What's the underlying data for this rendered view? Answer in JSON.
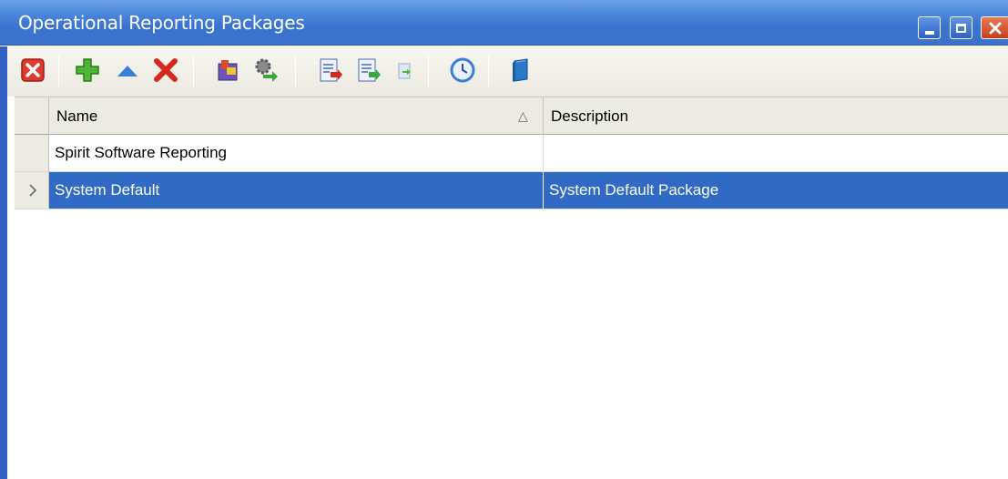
{
  "window": {
    "title": "Operational Reporting Packages",
    "buttons": [
      "minimize",
      "maximize",
      "close"
    ]
  },
  "toolbar": {
    "tools": [
      {
        "icon": "close-red-icon"
      },
      {
        "icon": "add-icon"
      },
      {
        "icon": "move-up-icon"
      },
      {
        "icon": "delete-icon"
      },
      {
        "icon": "package-icon"
      },
      {
        "icon": "gear-run-icon"
      },
      {
        "icon": "report-export-icon"
      },
      {
        "icon": "report-import-icon"
      },
      {
        "icon": "report-small-icon"
      },
      {
        "icon": "schedule-clock-icon"
      },
      {
        "icon": "book-icon"
      }
    ]
  },
  "grid": {
    "columns": [
      {
        "label": "Name",
        "sorted": "ascending"
      },
      {
        "label": "Description"
      }
    ],
    "rows": [
      {
        "name": "Spirit Software Reporting",
        "description": "",
        "selected": false
      },
      {
        "name": "System Default",
        "description": "System Default Package",
        "selected": true
      }
    ]
  },
  "colors": {
    "titlebar": "#3b72cc",
    "selection": "#316ac5",
    "close_button": "#d65a35"
  }
}
